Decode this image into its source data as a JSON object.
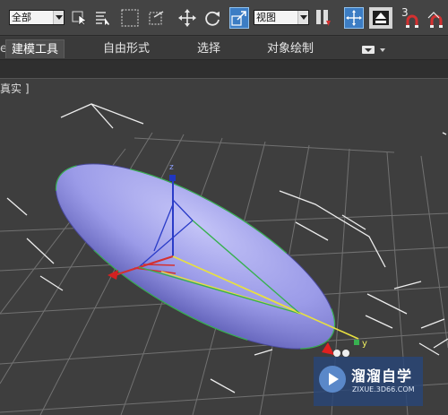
{
  "toolbar": {
    "selection_filter": "全部",
    "reference_coord": "视图",
    "snap_count": "3",
    "icons": [
      "select-object-icon",
      "select-by-name-icon",
      "rect-selection-icon",
      "window-crossing-icon",
      "move-icon",
      "rotate-icon",
      "scale-icon",
      "mirror-icon",
      "pivot-center-icon",
      "select-manipulate-icon",
      "snap-toggle-icon",
      "magnet-icon",
      "angle-snap-icon"
    ]
  },
  "ribbon": {
    "tabs": [
      "建模工具",
      "自由形式",
      "选择",
      "对象绘制"
    ],
    "active_tab": "建模工具",
    "tab_prefix": "e"
  },
  "viewport": {
    "label": "真实 ]",
    "object_color": "#9a9ae8",
    "gizmo_axes": {
      "x": "#d43030",
      "y": "#e8e040",
      "z": "#2a3cc8"
    },
    "axis_label_y": "y",
    "axis_label_z": "z"
  },
  "watermark": {
    "name": "溜溜自学",
    "url": "ZIXUE.3D66.COM"
  },
  "colors": {
    "toolbar_bg": "#444444",
    "accent": "#3c7dc4",
    "viewport_bg": "#3e3e3e",
    "grid": "#7a7a7a"
  }
}
